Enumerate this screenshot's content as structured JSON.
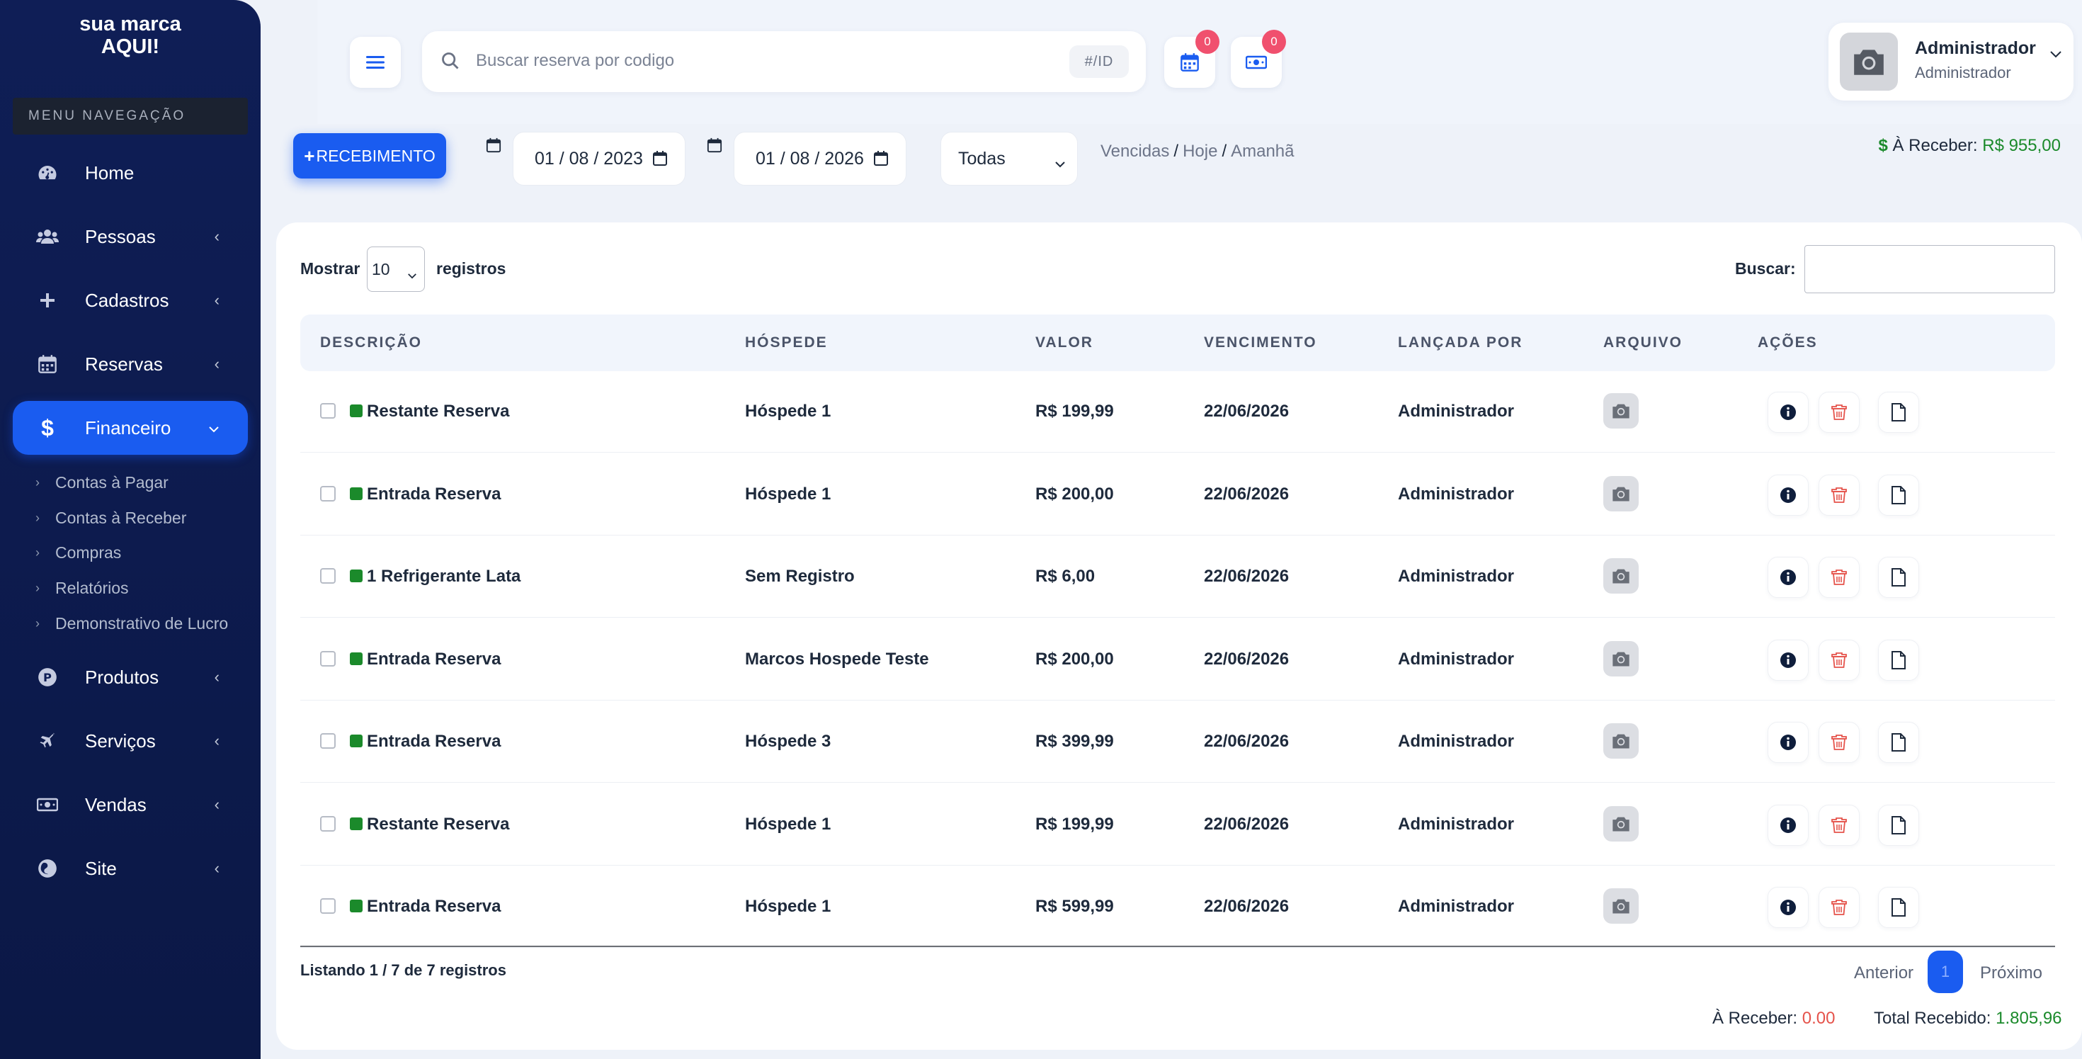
{
  "brand": {
    "line1": "sua marca",
    "line2": "AQUI!"
  },
  "sidebar": {
    "menu_label": "MENU NAVEGAÇÃO",
    "items": [
      {
        "label": "Home",
        "icon": "dashboard-icon"
      },
      {
        "label": "Pessoas",
        "icon": "users-icon"
      },
      {
        "label": "Cadastros",
        "icon": "plus-icon"
      },
      {
        "label": "Reservas",
        "icon": "calendar-icon"
      },
      {
        "label": "Financeiro",
        "icon": "dollar-icon"
      },
      {
        "label": "Produtos",
        "icon": "product-icon"
      },
      {
        "label": "Serviços",
        "icon": "plane-icon"
      },
      {
        "label": "Vendas",
        "icon": "money-icon"
      },
      {
        "label": "Site",
        "icon": "site-icon"
      }
    ],
    "submenu": [
      "Contas à Pagar",
      "Contas à Receber",
      "Compras",
      "Relatórios",
      "Demonstrativo de Lucro"
    ]
  },
  "header": {
    "search_placeholder": "Buscar reserva por codigo",
    "search_hint": "#/ID",
    "calendar_badge": "0",
    "money_badge": "0",
    "user_name": "Administrador",
    "user_role": "Administrador"
  },
  "filters": {
    "receive_button": "RECEBIMENTO",
    "date_from": "01 / 08 / 2023",
    "date_to": "01 / 08 / 2026",
    "status_select": "Todas",
    "quick_overdue": "Vencidas",
    "quick_today": "Hoje",
    "quick_tomorrow": "Amanhã",
    "receivable_label": "À Receber:",
    "receivable_value": "R$ 955,00"
  },
  "table_controls": {
    "show_label": "Mostrar",
    "page_size": "10",
    "records_label": "registros",
    "search_label": "Buscar:"
  },
  "table": {
    "headers": [
      "DESCRIÇÃO",
      "HÓSPEDE",
      "VALOR",
      "VENCIMENTO",
      "LANÇADA POR",
      "ARQUIVO",
      "AÇÕES"
    ],
    "rows": [
      {
        "descricao": "Restante Reserva",
        "hospede": "Hóspede 1",
        "valor": "R$ 199,99",
        "vencimento": "22/06/2026",
        "lancada_por": "Administrador"
      },
      {
        "descricao": "Entrada Reserva",
        "hospede": "Hóspede 1",
        "valor": "R$ 200,00",
        "vencimento": "22/06/2026",
        "lancada_por": "Administrador"
      },
      {
        "descricao": "1 Refrigerante Lata",
        "hospede": "Sem Registro",
        "valor": "R$ 6,00",
        "vencimento": "22/06/2026",
        "lancada_por": "Administrador"
      },
      {
        "descricao": "Entrada Reserva",
        "hospede": "Marcos Hospede Teste",
        "valor": "R$ 200,00",
        "vencimento": "22/06/2026",
        "lancada_por": "Administrador"
      },
      {
        "descricao": "Entrada Reserva",
        "hospede": "Hóspede 3",
        "valor": "R$ 399,99",
        "vencimento": "22/06/2026",
        "lancada_por": "Administrador"
      },
      {
        "descricao": "Restante Reserva",
        "hospede": "Hóspede 1",
        "valor": "R$ 199,99",
        "vencimento": "22/06/2026",
        "lancada_por": "Administrador"
      },
      {
        "descricao": "Entrada Reserva",
        "hospede": "Hóspede 1",
        "valor": "R$ 599,99",
        "vencimento": "22/06/2026",
        "lancada_por": "Administrador"
      }
    ]
  },
  "footer": {
    "listing": "Listando 1 / 7 de 7 registros",
    "prev": "Anterior",
    "page": "1",
    "next": "Próximo",
    "to_receive_label": "À Receber:",
    "to_receive_value": "0.00",
    "total_received_label": "Total Recebido:",
    "total_received_value": "1.805,96"
  },
  "colors": {
    "sidebar": "#0f1e56",
    "accent": "#1a5cf0",
    "status_paid": "#1b8a2b",
    "badge": "#f0506e"
  }
}
